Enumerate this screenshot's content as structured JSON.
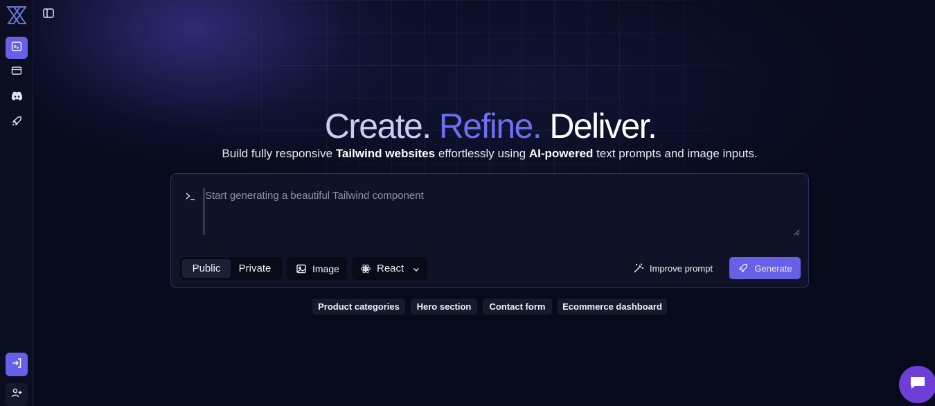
{
  "sidebar": {
    "logo_icon": "x-logo-icon",
    "nav_icons": [
      "terminal-icon",
      "card-icon",
      "discord-icon",
      "rocket-icon"
    ],
    "bottom_icons": [
      "sign-in-icon",
      "user-plus-icon"
    ],
    "accent_color": "#6660e8"
  },
  "hero": {
    "title_part1": "Create.",
    "title_part2": "Refine.",
    "title_part3": "Deliver.",
    "subtitle_1": "Build fully responsive ",
    "subtitle_bold_1": "Tailwind websites",
    "subtitle_2": " effortlessly using ",
    "subtitle_bold_2": "AI-powered",
    "subtitle_3": " text prompts and image inputs."
  },
  "prompt": {
    "placeholder": "Start generating a beautiful Tailwind component",
    "value": "",
    "visibility_options": [
      "Public",
      "Private"
    ],
    "visibility_selected": "Public",
    "image_label": "Image",
    "framework_label": "React",
    "improve_label": "Improve prompt",
    "generate_label": "Generate"
  },
  "suggestions": [
    "Product categories",
    "Hero section",
    "Contact form",
    "Ecommerce dashboard"
  ]
}
